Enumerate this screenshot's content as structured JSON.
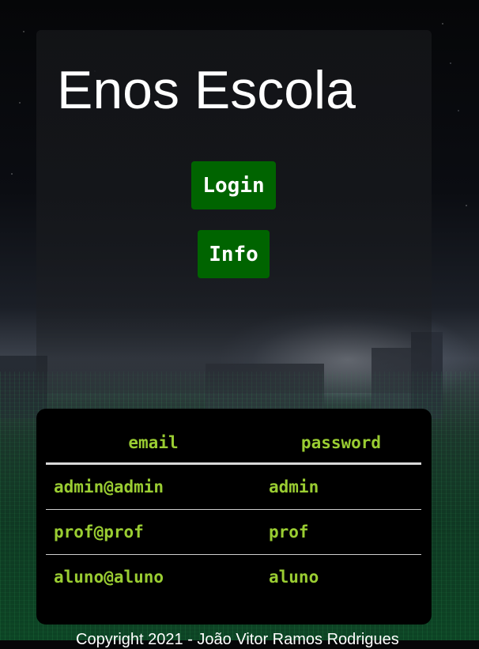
{
  "header": {
    "title": "Enos Escola"
  },
  "actions": {
    "login_label": "Login",
    "info_label": "Info"
  },
  "credentials": {
    "headers": {
      "email": "email",
      "password": "password"
    },
    "rows": [
      {
        "email": "admin@admin",
        "password": "admin"
      },
      {
        "email": "prof@prof",
        "password": "prof"
      },
      {
        "email": "aluno@aluno",
        "password": "aluno"
      }
    ]
  },
  "footer": {
    "text": "Copyright 2021 - João Vitor Ramos Rodrigues"
  },
  "colors": {
    "button_bg": "#006400",
    "button_text": "#ffffff",
    "table_text": "#9acd32",
    "card_bg": "#000000"
  }
}
